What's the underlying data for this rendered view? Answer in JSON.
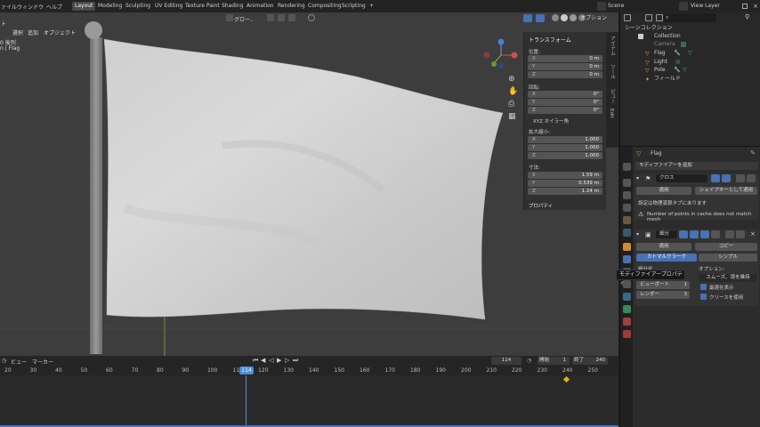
{
  "menu": {
    "items": [
      "ァイル",
      "ウィンドウ",
      "ヘルプ"
    ],
    "workspaces": [
      "Layout",
      "Modeling",
      "Sculpting",
      "UV Editing",
      "Texture Paint",
      "Shading",
      "Animation",
      "Rendering",
      "Compositing",
      "Scripting",
      "+"
    ],
    "active_workspace": "Layout",
    "scene": "Scene",
    "view_layer": "View Layer"
  },
  "viewport": {
    "header_menus": [
      "選択",
      "追加",
      "オブジェクト"
    ],
    "mode_partial": "ト",
    "info_line1": "0 後列",
    "info_line2": "n | Flag",
    "transform_orientation": "グロー..",
    "options_label": "オプション",
    "tabs": [
      "アイテム",
      "ツール",
      "ビュー",
      "Edit"
    ]
  },
  "transform_panel": {
    "title": "トランスフォーム",
    "location_label": "位置:",
    "location": [
      {
        "k": "X",
        "v": "0 m"
      },
      {
        "k": "Y",
        "v": "0 m"
      },
      {
        "k": "Z",
        "v": "0 m"
      }
    ],
    "rotation_label": "回転:",
    "rotation": [
      {
        "k": "X",
        "v": "0°"
      },
      {
        "k": "Y",
        "v": "0°"
      },
      {
        "k": "Z",
        "v": "0°"
      }
    ],
    "rotation_mode": "XYZ オイラー角",
    "scale_label": "拡大縮小:",
    "scale": [
      {
        "k": "X",
        "v": "1.000"
      },
      {
        "k": "Y",
        "v": "1.000"
      },
      {
        "k": "Z",
        "v": "1.000"
      }
    ],
    "dims_label": "寸法:",
    "dims": [
      {
        "k": "X",
        "v": "1.59 m"
      },
      {
        "k": "Y",
        "v": "0.539 m"
      },
      {
        "k": "Z",
        "v": "1.24 m"
      }
    ],
    "properties_label": "プロパティ"
  },
  "outliner": {
    "title": "シーンコレクション",
    "rows": [
      "Collection",
      "Camera",
      "Flag",
      "Light",
      "Pole",
      "フィールド"
    ]
  },
  "properties": {
    "object_name": "Flag",
    "add_modifier": "モディファイアーを追加",
    "cloth_name": "クロス",
    "apply": "適用",
    "apply_as_shape": "シェイプキーとして適用",
    "cloth_note": "設定は物理演算タブにあります",
    "warning": "Number of points in cache does not match mesh",
    "subsurf_name": "細分",
    "copy": "コピー",
    "catmull": "カトマルクラーク",
    "simple": "シンプル",
    "subdiv_label": "細分化",
    "viewport_label": "ビューポート",
    "viewport_value": "1",
    "render_label": "レンダー",
    "render_value": "3",
    "options_label": "オプション:",
    "smooth_label": "スムーズ、境を維持",
    "optimal_label": "最適化表示",
    "crease_label": "クリースを使用"
  },
  "tooltip": "モディファイアープロパティ",
  "timeline": {
    "menus": [
      "ビュー",
      "マーカー"
    ],
    "current_frame": "114",
    "start_label": "開始",
    "start": "1",
    "end_label": "終了",
    "end": "240",
    "ticks": [
      "20",
      "30",
      "40",
      "50",
      "60",
      "70",
      "80",
      "90",
      "100",
      "110",
      "114",
      "120",
      "130",
      "140",
      "150",
      "160",
      "170",
      "180",
      "190",
      "200",
      "210",
      "220",
      "230",
      "240",
      "250"
    ]
  },
  "colors": {
    "accent": "#4772b3",
    "playhead": "#4a8fd8",
    "warning": "#e0e0e0",
    "keyframe": "#e8b400"
  }
}
